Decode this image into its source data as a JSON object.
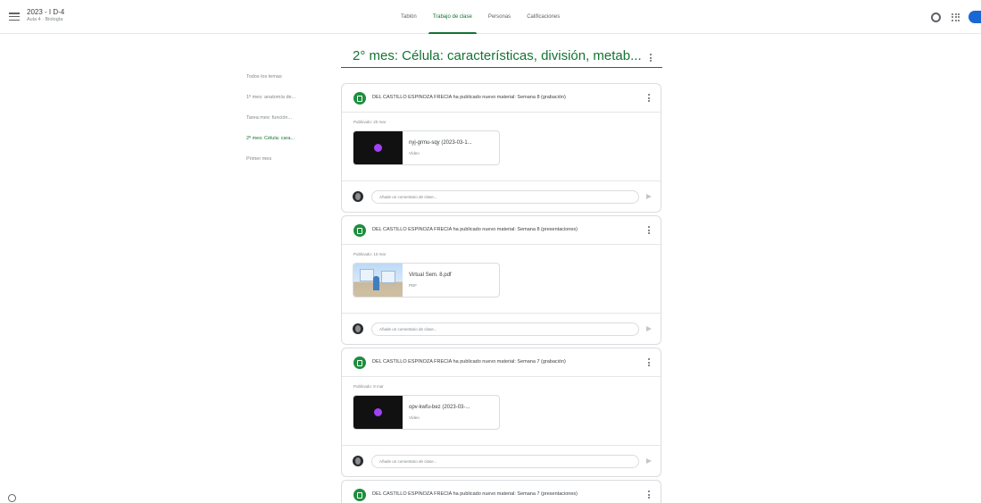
{
  "header": {
    "course_title": "2023 - I D-4",
    "course_subtitle": "Aula 4 · Biología",
    "tabs": [
      {
        "label": "Tablón"
      },
      {
        "label": "Trabajo de clase"
      },
      {
        "label": "Personas"
      },
      {
        "label": "Calificaciones"
      }
    ],
    "active_tab": "Trabajo de clase",
    "icons": [
      "menu-icon",
      "gear-icon",
      "apps-grid-icon",
      "account-avatar"
    ]
  },
  "sidebar": {
    "items": [
      {
        "label": "Todos los temas"
      },
      {
        "label": "1º mes: anatomía de..."
      },
      {
        "label": "Tarea mes: función..."
      },
      {
        "label": "2º mes: Célula: cara..."
      },
      {
        "label": "Primer mes"
      }
    ],
    "active_index": 3
  },
  "topic": {
    "title": "2° mes: Célula: características, división, metab..."
  },
  "posts": [
    {
      "title": "DEL CASTILLO ESPINOZA FRECIA ha publicado nuevo material: Semana 8 (grabación)",
      "published": "Publicado: 20 mar",
      "attachment": {
        "name": "nyj-grmu-sqy (2023-03-1...",
        "type": "Vídeo",
        "kind": "video"
      },
      "comment_placeholder": "Añade un comentario de clase..."
    },
    {
      "title": "DEL CASTILLO ESPINOZA FRECIA ha publicado nuevo material: Semana 8 (presentaciones)",
      "published": "Publicado: 13 mar",
      "attachment": {
        "name": "Virtual Sem. 8.pdf",
        "type": "PDF",
        "kind": "pdf"
      },
      "comment_placeholder": "Añade un comentario de clase..."
    },
    {
      "title": "DEL CASTILLO ESPINOZA FRECIA ha publicado nuevo material: Semana 7 (grabación)",
      "published": "Publicado: 8 mar",
      "attachment": {
        "name": "opv-kwfu-bez (2023-03-...",
        "type": "Vídeo",
        "kind": "video"
      },
      "comment_placeholder": "Añade un comentario de clase..."
    },
    {
      "title": "DEL CASTILLO ESPINOZA FRECIA ha publicado nuevo material: Semana 7 (presentaciones)"
    }
  ],
  "colors": {
    "accent": "#137333",
    "material_icon": "#1e8e3e",
    "video_dot": "#a142f4"
  }
}
